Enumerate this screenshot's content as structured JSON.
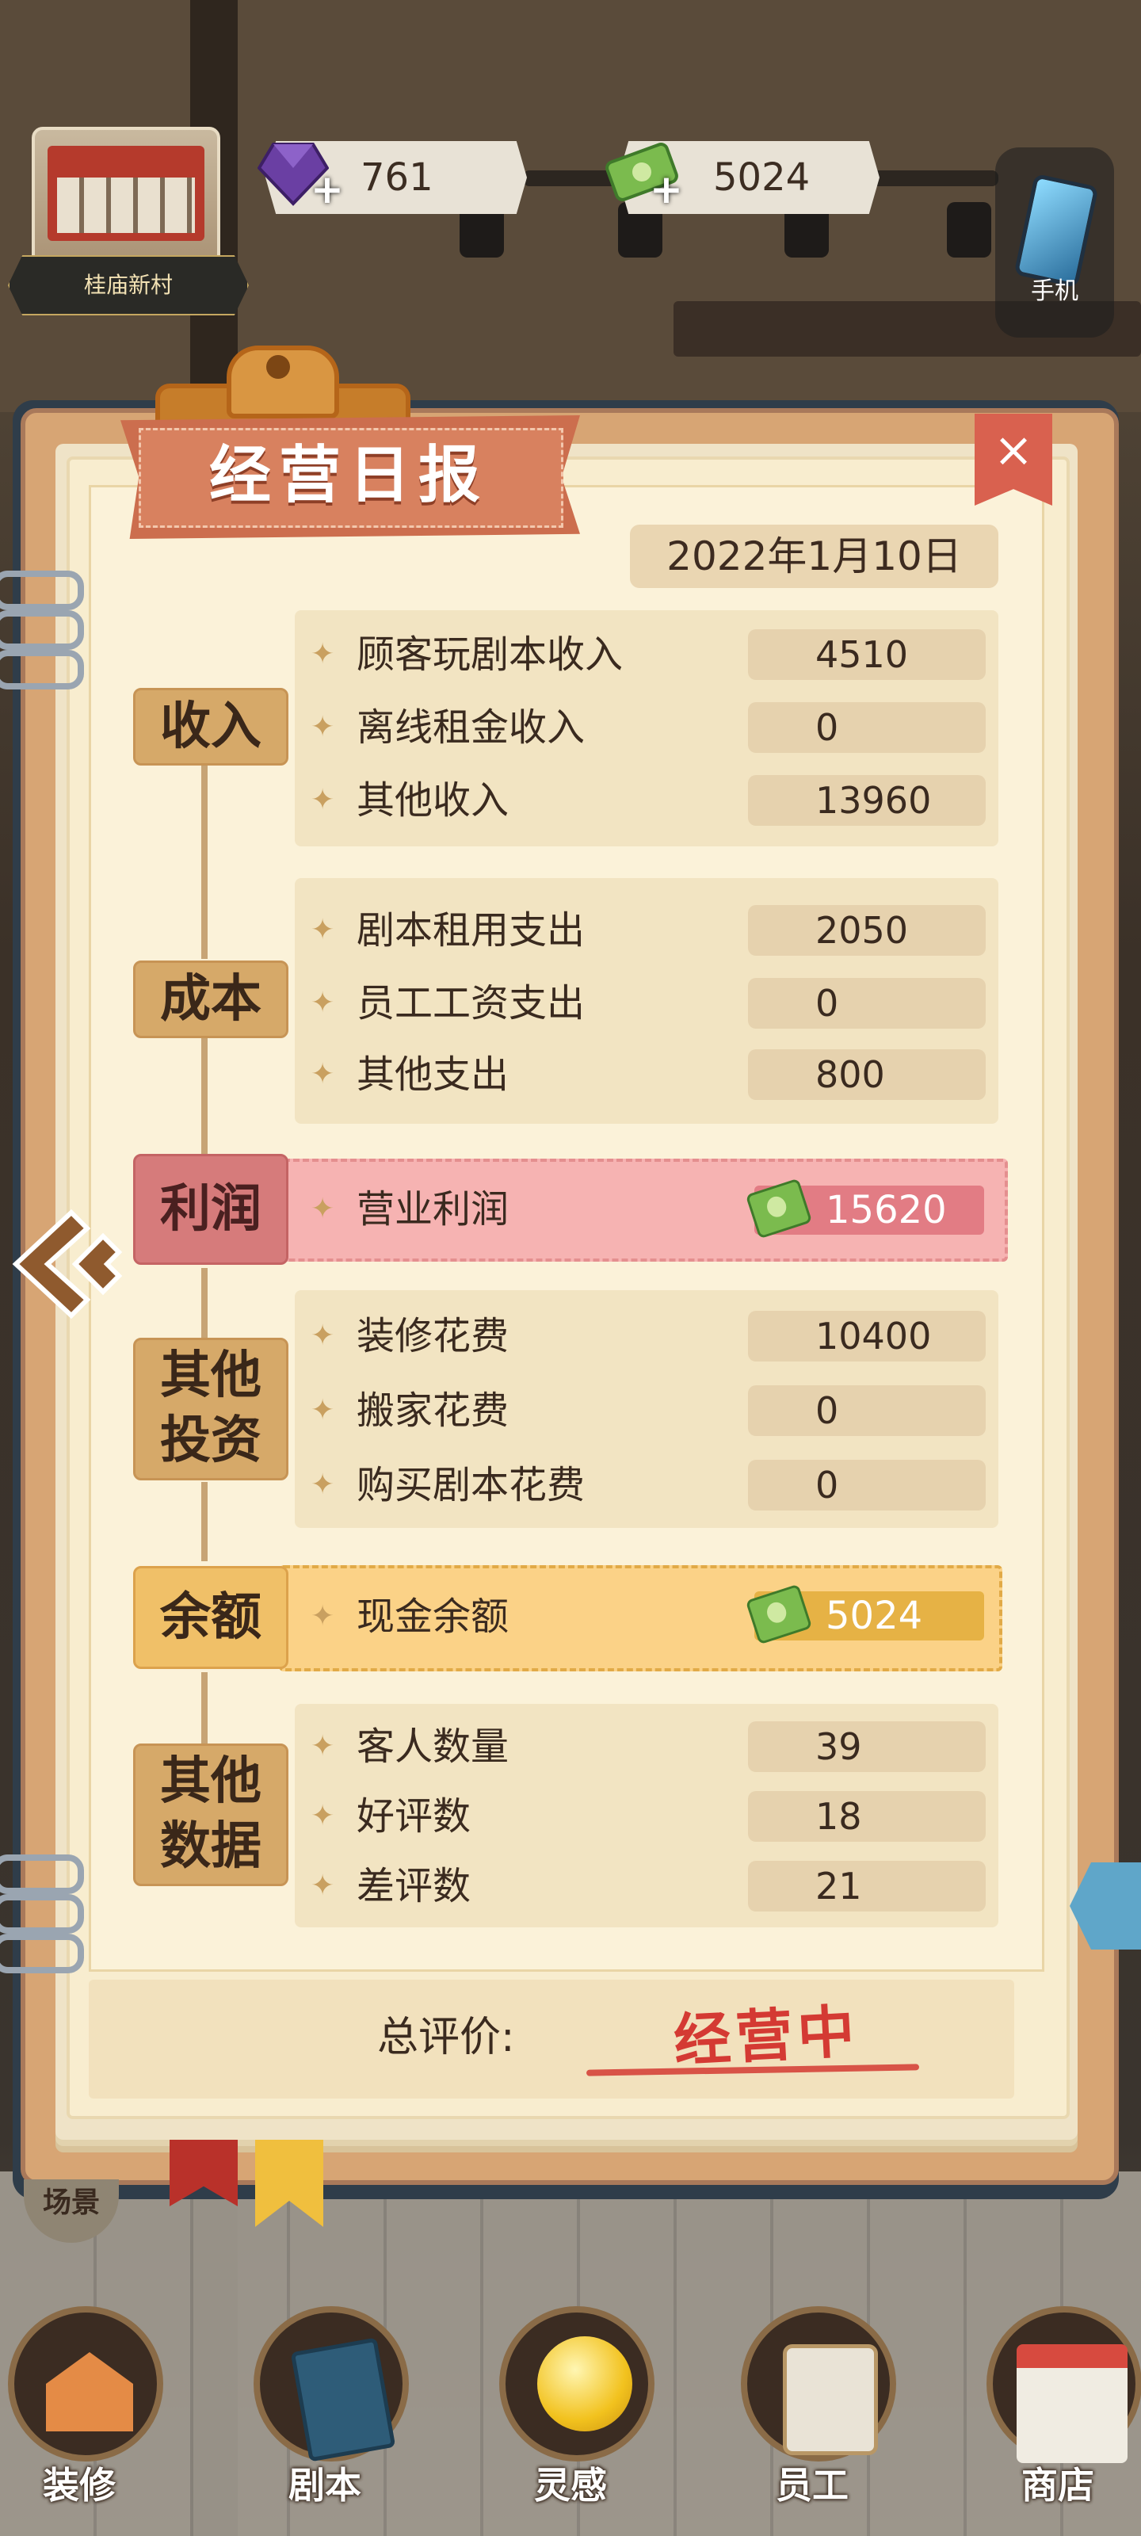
{
  "hud": {
    "location": "桂庙新村",
    "gems": "761",
    "cash": "5024",
    "phone_label": "手机",
    "plus": "+"
  },
  "report": {
    "title": "经营日报",
    "close": "×",
    "date": "2022年1月10日",
    "sections": {
      "income": {
        "tag": "收入",
        "rows": [
          {
            "label": "顾客玩剧本收入",
            "value": "4510"
          },
          {
            "label": "离线租金收入",
            "value": "0"
          },
          {
            "label": "其他收入",
            "value": "13960"
          }
        ]
      },
      "cost": {
        "tag": "成本",
        "rows": [
          {
            "label": "剧本租用支出",
            "value": "2050"
          },
          {
            "label": "员工工资支出",
            "value": "0"
          },
          {
            "label": "其他支出",
            "value": "800"
          }
        ]
      },
      "profit": {
        "tag": "利润",
        "label": "营业利润",
        "value": "15620"
      },
      "investment": {
        "tag": "其他投资",
        "rows": [
          {
            "label": "装修花费",
            "value": "10400"
          },
          {
            "label": "搬家花费",
            "value": "0"
          },
          {
            "label": "购买剧本花费",
            "value": "0"
          }
        ]
      },
      "balance": {
        "tag": "余额",
        "label": "现金余额",
        "value": "5024"
      },
      "other": {
        "tag": "其他数据",
        "rows": [
          {
            "label": "客人数量",
            "value": "39"
          },
          {
            "label": "好评数",
            "value": "18"
          },
          {
            "label": "差评数",
            "value": "21"
          }
        ]
      }
    },
    "overall_label": "总评价:",
    "overall_value": "经营中"
  },
  "scene_button": "场景",
  "nav": {
    "decorate": "装修",
    "script": "剧本",
    "inspiration": "灵感",
    "staff": "员工",
    "shop": "商店"
  },
  "colors": {
    "profit_bg": "#f6b3b2",
    "balance_bg": "#fbd287",
    "stamp_red": "#d43a33"
  }
}
